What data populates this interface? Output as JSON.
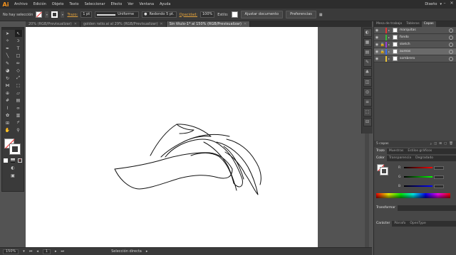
{
  "app": {
    "logo": "Ai"
  },
  "menu": [
    "Archivo",
    "Edición",
    "Objeto",
    "Texto",
    "Seleccionar",
    "Efecto",
    "Ver",
    "Ventana",
    "Ayuda"
  ],
  "workspace": {
    "label": "Diseño"
  },
  "controlbar": {
    "selection_text": "No hay selección",
    "stroke_label": "Trazo:",
    "stroke_weight": "1 pt",
    "profile": "Uniforme",
    "brush": "Redondo 5 pt.",
    "opacity_label": "Opacidad:",
    "opacity_value": "100%",
    "style_label": "Estilo:",
    "doc_setup_button": "Ajustar documento",
    "preferences_button": "Preferencias"
  },
  "tabs": [
    {
      "label": "20% (RGB/Previsualizar)",
      "active": false
    },
    {
      "label": "golden ratio.ai al 29% (RGB/Previsualizar)",
      "active": false
    },
    {
      "label": "Sin título-1* al 150% (RGB/Previsualizar)",
      "active": true
    }
  ],
  "status": {
    "zoom": "150%",
    "page": "1",
    "tool": "Selección directa"
  },
  "panels": {
    "top_tabs": [
      "Mesa de trabajo",
      "Tableros",
      "Capas"
    ],
    "active_top_tab": "Capas",
    "layers": [
      {
        "name": "marquitas",
        "color": "#e23636",
        "visible": true,
        "locked": false,
        "selected": false
      },
      {
        "name": "fondo",
        "color": "#3bb83b",
        "visible": true,
        "locked": false,
        "selected": false
      },
      {
        "name": "sketch",
        "color": "#9a3ad8",
        "visible": true,
        "locked": true,
        "selected": false
      },
      {
        "name": "aureas",
        "color": "#3a6ee8",
        "visible": true,
        "locked": true,
        "selected": true
      },
      {
        "name": "sombrero",
        "color": "#e9c23a",
        "visible": true,
        "locked": false,
        "selected": false
      }
    ],
    "layers_count": "5 capas",
    "stroke_tabs": [
      "Trazo",
      "Muestras",
      "Estilos gráficos"
    ],
    "color_tabs": [
      "Color",
      "Transparencia",
      "Degradado"
    ],
    "color_sliders": [
      "R",
      "G",
      "B"
    ],
    "transform_tab": "Transformar",
    "bottom_tabs": [
      "Carácter",
      "Párrafo",
      "OpenType"
    ]
  },
  "tools": [
    "selection-tool",
    "direct-selection-tool",
    "magic-wand-tool",
    "lasso-tool",
    "pen-tool",
    "type-tool",
    "line-tool",
    "rectangle-tool",
    "paintbrush-tool",
    "pencil-tool",
    "blob-brush-tool",
    "eraser-tool",
    "rotate-tool",
    "scale-tool",
    "width-tool",
    "free-transform-tool",
    "shape-builder-tool",
    "perspective-tool",
    "mesh-tool",
    "gradient-tool",
    "eyedropper-tool",
    "blend-tool",
    "symbol-sprayer-tool",
    "column-graph-tool",
    "artboard-tool",
    "slice-tool",
    "hand-tool",
    "zoom-tool"
  ]
}
